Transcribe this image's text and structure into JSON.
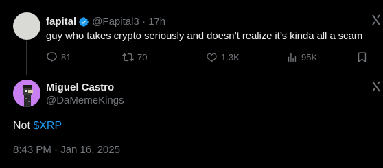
{
  "parent_tweet": {
    "author_name": "fapital",
    "handle_time": "@Fapital3 · 17h",
    "text": "guy who takes crypto seriously and doesn’t realize it’s kinda all a scam",
    "stats": {
      "replies": "81",
      "reposts": "70",
      "likes": "1.3K",
      "views": "95K"
    }
  },
  "reply_tweet": {
    "author_name": "Miguel Castro",
    "handle": "@DaMemeKings",
    "text_prefix": "Not",
    "cashtag": "$XRP",
    "timestamp": "8:43 PM · Jan 16, 2025"
  },
  "icons": {
    "verified": "verified-badge-icon",
    "grok": "grok-icon",
    "reply": "reply-icon",
    "repost": "repost-icon",
    "like": "heart-icon",
    "views": "views-icon",
    "bookmark": "bookmark-icon"
  },
  "colors": {
    "background": "#000000",
    "text": "#e7e9ea",
    "muted": "#71767b",
    "accent": "#1d9bf0"
  }
}
